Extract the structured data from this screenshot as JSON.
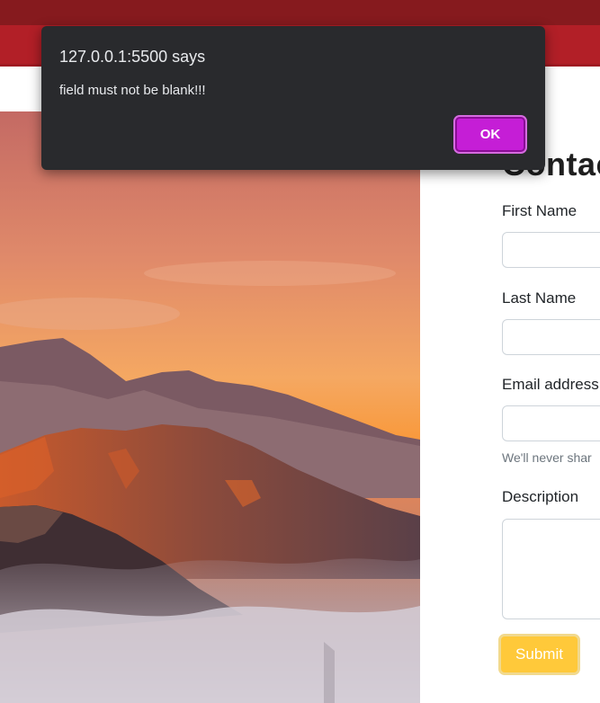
{
  "dialog": {
    "title": "127.0.0.1:5500 says",
    "message": "field must not be blank!!!",
    "ok_label": "OK"
  },
  "form": {
    "title": "Contac",
    "first_name_label": "First Name",
    "last_name_label": "Last Name",
    "email_label": "Email address",
    "email_help": "We'll never shar",
    "description_label": "Description",
    "submit_label": "Submit"
  },
  "colors": {
    "navbar": "#b21f27",
    "browser_top": "#861a1e",
    "dialog_bg": "#292a2d",
    "dialog_button": "#c51ed6",
    "submit_button": "#ffc93a"
  },
  "hero": {
    "icon": "mountain-sunrise-image"
  }
}
